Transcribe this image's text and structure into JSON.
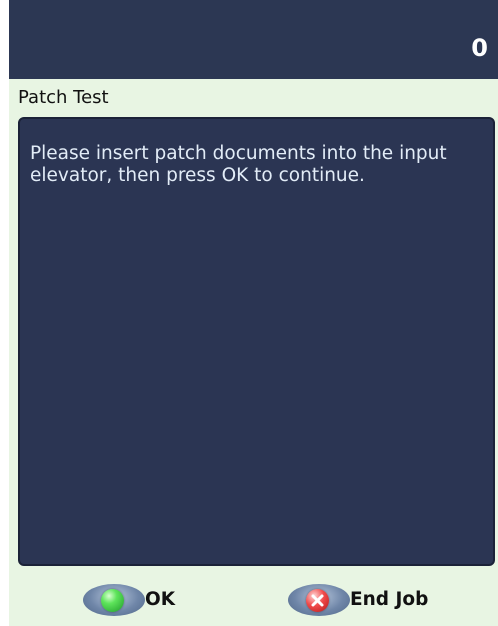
{
  "header": {
    "count": "0"
  },
  "dialog": {
    "title": "Patch Test",
    "message": "Please insert patch documents into the input elevator, then press OK to continue."
  },
  "buttons": {
    "ok": {
      "label": "OK",
      "icon": "green-circle-icon"
    },
    "end_job": {
      "label": "End Job",
      "icon": "red-x-icon"
    }
  },
  "colors": {
    "background": "#2a3550",
    "panel": "#e8f5e3",
    "message_text": "#e2ecf7"
  }
}
